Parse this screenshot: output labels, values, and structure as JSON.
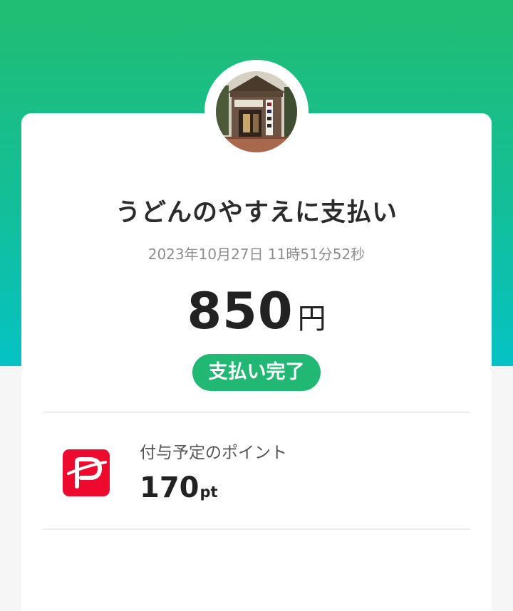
{
  "payment": {
    "merchant_title": "うどんのやすえに支払い",
    "datetime": "2023年10月27日 11時51分52秒",
    "amount": "850",
    "currency": "円",
    "status_badge": "支払い完了"
  },
  "points": {
    "label": "付与予定のポイント",
    "value": "170",
    "unit": "pt"
  },
  "colors": {
    "header_gradient_top": "#21bd72",
    "header_gradient_bottom": "#05c2c4",
    "status_green": "#21b874",
    "paypay_red": "#ee0a2e"
  },
  "icons": {
    "merchant_avatar": "merchant-photo-icon",
    "paypay_logo": "paypay-logo-icon"
  }
}
